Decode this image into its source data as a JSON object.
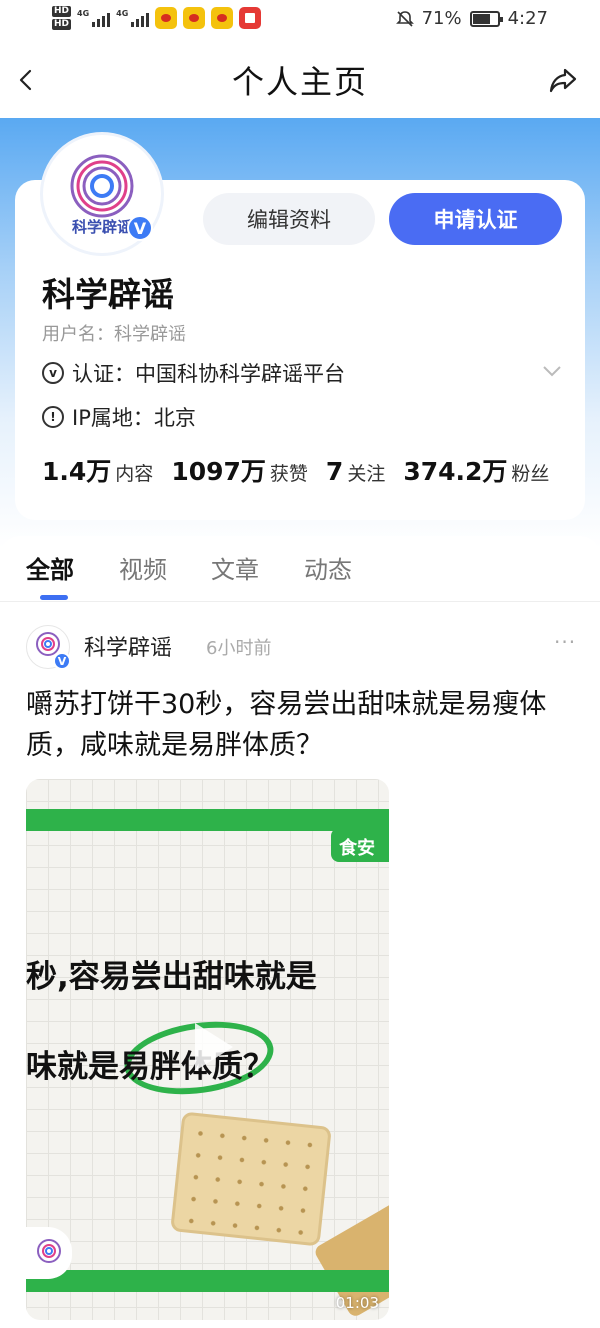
{
  "status_bar": {
    "battery_percent": "71%",
    "time": "4:27",
    "network_1": "4G",
    "network_2": "4G"
  },
  "nav": {
    "title": "个人主页"
  },
  "profile": {
    "avatar_text": "科学辟谣",
    "edit_label": "编辑资料",
    "verify_label": "申请认证",
    "name": "科学辟谣",
    "username_label": "用户名：",
    "username": "科学辟谣",
    "auth_text": "认证：中国科协科学辟谣平台",
    "ip_text": "IP属地：北京",
    "stats": [
      {
        "value": "1.4万",
        "label": "内容"
      },
      {
        "value": "1097万",
        "label": "获赞"
      },
      {
        "value": "7",
        "label": "关注"
      },
      {
        "value": "374.2万",
        "label": "粉丝"
      }
    ]
  },
  "tabs": [
    "全部",
    "视频",
    "文章",
    "动态"
  ],
  "post": {
    "author": "科学辟谣",
    "time": "6小时前",
    "more": "···",
    "text": "嚼苏打饼干30秒，容易尝出甜味就是易瘦体质，咸味就是易胖体质？",
    "video": {
      "tag": "食安",
      "line1": "秒,容易尝出甜味就是",
      "line2": "味就是易胖体质？",
      "duration": "01:03"
    }
  },
  "colors": {
    "accent": "#4a6cf3",
    "video_green": "#2eb24a"
  }
}
